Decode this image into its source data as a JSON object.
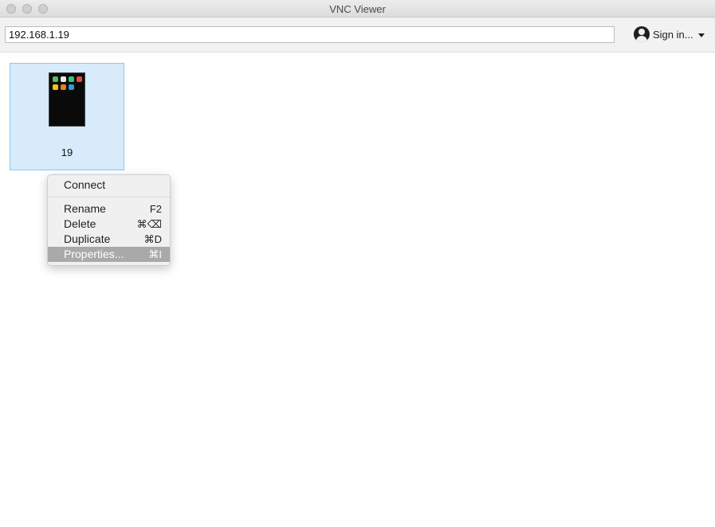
{
  "window": {
    "title": "VNC Viewer"
  },
  "toolbar": {
    "address_value": "192.168.1.19",
    "signin_label": "Sign in...",
    "signin_icon": "user-icon",
    "caret_icon": "chevron-down-icon"
  },
  "tile": {
    "label": "19"
  },
  "context_menu": {
    "items": [
      {
        "label": "Connect",
        "shortcut": ""
      },
      {
        "label": "Rename",
        "shortcut": "F2"
      },
      {
        "label": "Delete",
        "shortcut": "⌘⌫"
      },
      {
        "label": "Duplicate",
        "shortcut": "⌘D"
      },
      {
        "label": "Properties...",
        "shortcut": "⌘I"
      }
    ],
    "selected_index": 4
  },
  "colors": {
    "tile_bg": "#d7ebfb",
    "tile_border": "#8ec6ee",
    "menu_highlight": "#a9a9a9"
  }
}
